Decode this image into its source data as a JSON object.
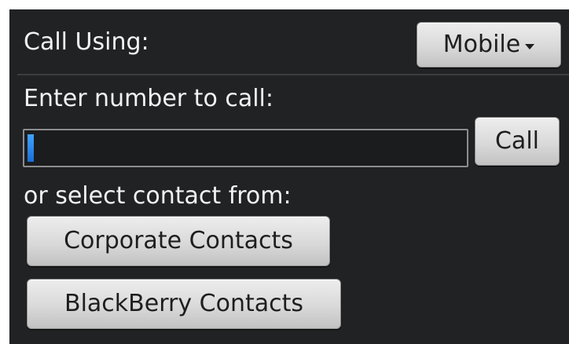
{
  "call_using": {
    "label": "Call Using:",
    "selected": "Mobile"
  },
  "number_entry": {
    "label": "Enter number to call:",
    "value": "",
    "call_button": "Call"
  },
  "contacts": {
    "label": "or select contact from:",
    "corporate_button": "Corporate Contacts",
    "blackberry_button": "BlackBerry Contacts"
  },
  "colors": {
    "background": "#202224",
    "text": "#f2f2f2",
    "button": "#d9d9d9",
    "caret": "#2a8af0"
  }
}
